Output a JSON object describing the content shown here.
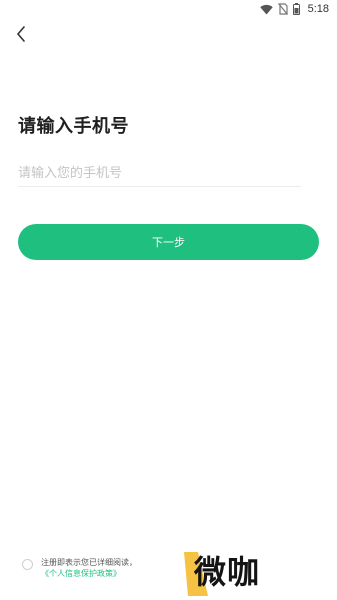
{
  "status_bar": {
    "time": "5:18",
    "icons": [
      "wifi-icon",
      "no-sim-icon",
      "battery-icon"
    ]
  },
  "nav": {
    "back_icon": "chevron-left-icon"
  },
  "main": {
    "title": "请输入手机号",
    "phone_input": {
      "value": "",
      "placeholder": "请输入您的手机号"
    },
    "next_button_label": "下一步"
  },
  "footer": {
    "agreement_prefix": "注册即表示您已详细阅读，",
    "policy_link": "《个人信息保护政策》",
    "agreed": false
  },
  "watermark": {
    "text": "微咖"
  },
  "colors": {
    "accent": "#1fc07f",
    "watermark_accent": "#f6c244"
  }
}
